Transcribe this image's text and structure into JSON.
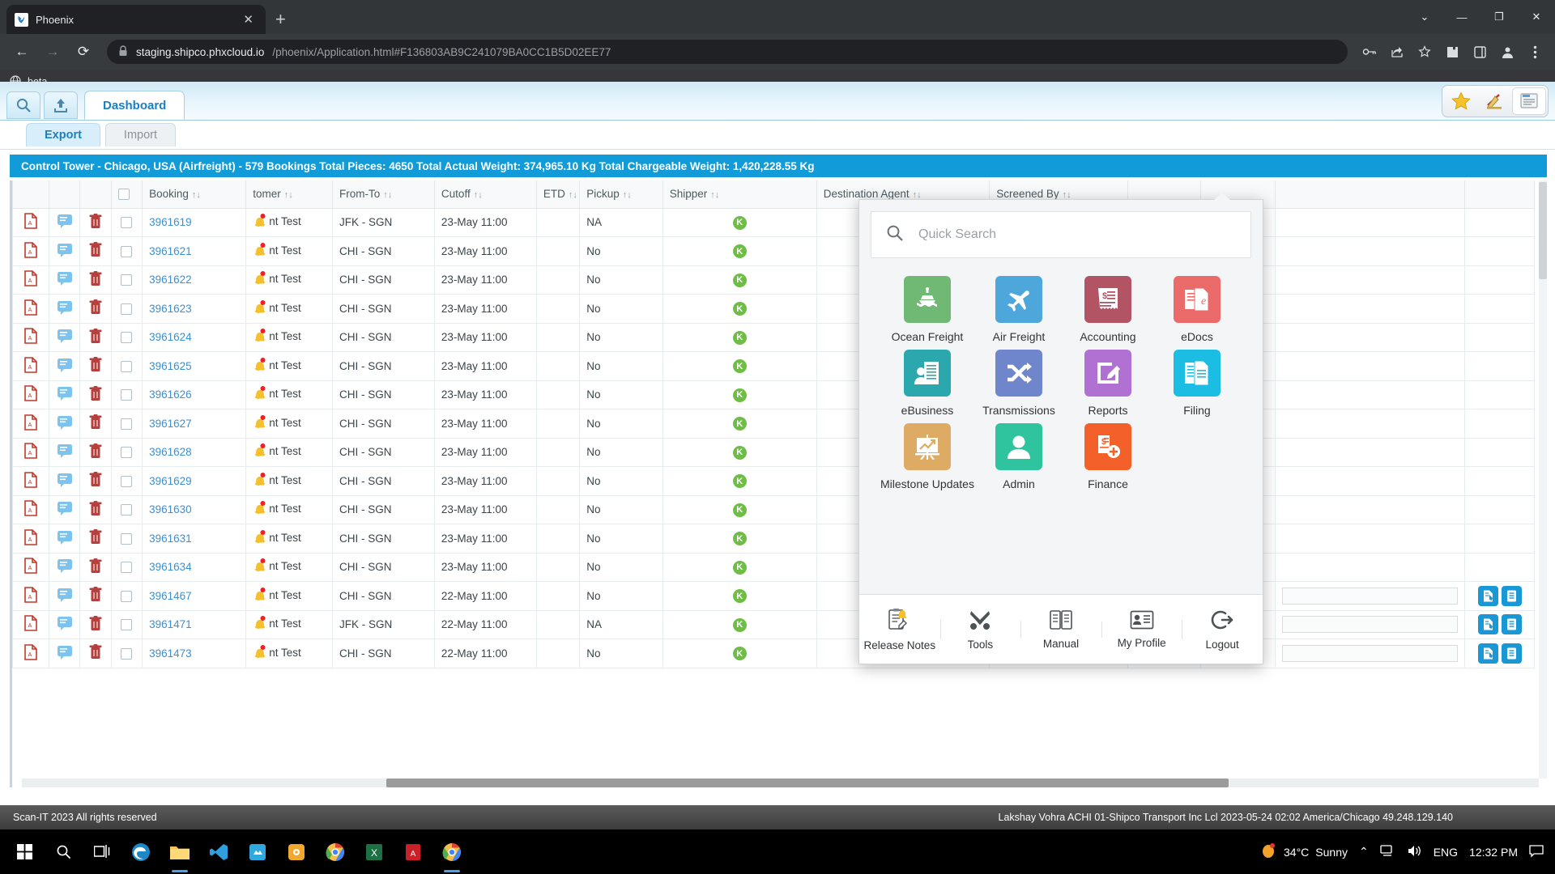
{
  "browser": {
    "tab_title": "Phoenix",
    "tab_close": "✕",
    "new_tab": "+",
    "url_host": "staging.shipco.phxcloud.io",
    "url_rest": "/phoenix/Application.html#F136803AB9C241079BA0CC1B5D02EE77",
    "back": "←",
    "forward": "→",
    "reload": "⟳",
    "bookmark_label": "beta",
    "win_minimize": "—",
    "win_maximize": "❐",
    "win_close": "✕",
    "win_chevron": "⌄"
  },
  "app": {
    "tab_dashboard": "Dashboard",
    "subtab_export": "Export",
    "subtab_import": "Import",
    "info_bar": "Control Tower - Chicago, USA (Airfreight) - 579 Bookings Total Pieces: 4650 Total Actual Weight: 374,965.10 Kg Total Chargeable Weight: 1,420,228.55 Kg"
  },
  "table": {
    "columns": [
      "Booking",
      "tomer",
      "From-To",
      "Cutoff",
      "ETD",
      "Pickup",
      "Shipper",
      "Destination Agent",
      "Screened By"
    ],
    "sort_glyph": "↑↓",
    "rows": [
      {
        "booking": "3961619",
        "customer": "nt Test",
        "fromto": "JFK - SGN",
        "cutoff": "23-May 11:00",
        "etd": "",
        "pickup": "NA",
        "shipper": "K",
        "dest_agent": "",
        "screened_by": ""
      },
      {
        "booking": "3961621",
        "customer": "nt Test",
        "fromto": "CHI - SGN",
        "cutoff": "23-May 11:00",
        "etd": "",
        "pickup": "No",
        "shipper": "K",
        "dest_agent": "",
        "screened_by": ""
      },
      {
        "booking": "3961622",
        "customer": "nt Test",
        "fromto": "CHI - SGN",
        "cutoff": "23-May 11:00",
        "etd": "",
        "pickup": "No",
        "shipper": "K",
        "dest_agent": "",
        "screened_by": ""
      },
      {
        "booking": "3961623",
        "customer": "nt Test",
        "fromto": "CHI - SGN",
        "cutoff": "23-May 11:00",
        "etd": "",
        "pickup": "No",
        "shipper": "K",
        "dest_agent": "",
        "screened_by": ""
      },
      {
        "booking": "3961624",
        "customer": "nt Test",
        "fromto": "CHI - SGN",
        "cutoff": "23-May 11:00",
        "etd": "",
        "pickup": "No",
        "shipper": "K",
        "dest_agent": "",
        "screened_by": ""
      },
      {
        "booking": "3961625",
        "customer": "nt Test",
        "fromto": "CHI - SGN",
        "cutoff": "23-May 11:00",
        "etd": "",
        "pickup": "No",
        "shipper": "K",
        "dest_agent": "",
        "screened_by": ""
      },
      {
        "booking": "3961626",
        "customer": "nt Test",
        "fromto": "CHI - SGN",
        "cutoff": "23-May 11:00",
        "etd": "",
        "pickup": "No",
        "shipper": "K",
        "dest_agent": "",
        "screened_by": ""
      },
      {
        "booking": "3961627",
        "customer": "nt Test",
        "fromto": "CHI - SGN",
        "cutoff": "23-May 11:00",
        "etd": "",
        "pickup": "No",
        "shipper": "K",
        "dest_agent": "",
        "screened_by": ""
      },
      {
        "booking": "3961628",
        "customer": "nt Test",
        "fromto": "CHI - SGN",
        "cutoff": "23-May 11:00",
        "etd": "",
        "pickup": "No",
        "shipper": "K",
        "dest_agent": "",
        "screened_by": ""
      },
      {
        "booking": "3961629",
        "customer": "nt Test",
        "fromto": "CHI - SGN",
        "cutoff": "23-May 11:00",
        "etd": "",
        "pickup": "No",
        "shipper": "K",
        "dest_agent": "",
        "screened_by": ""
      },
      {
        "booking": "3961630",
        "customer": "nt Test",
        "fromto": "CHI - SGN",
        "cutoff": "23-May 11:00",
        "etd": "",
        "pickup": "No",
        "shipper": "K",
        "dest_agent": "",
        "screened_by": ""
      },
      {
        "booking": "3961631",
        "customer": "nt Test",
        "fromto": "CHI - SGN",
        "cutoff": "23-May 11:00",
        "etd": "",
        "pickup": "No",
        "shipper": "K",
        "dest_agent": "",
        "screened_by": ""
      },
      {
        "booking": "3961634",
        "customer": "nt Test",
        "fromto": "CHI - SGN",
        "cutoff": "23-May 11:00",
        "etd": "",
        "pickup": "No",
        "shipper": "K",
        "dest_agent": "",
        "screened_by": ""
      },
      {
        "booking": "3961467",
        "customer": "nt Test",
        "fromto": "CHI - SGN",
        "cutoff": "22-May 11:00",
        "etd": "",
        "pickup": "No",
        "shipper": "K",
        "dest_agent": "",
        "screened_by": ""
      },
      {
        "booking": "3961471",
        "customer": "nt Test",
        "fromto": "JFK - SGN",
        "cutoff": "22-May 11:00",
        "etd": "",
        "pickup": "NA",
        "shipper": "K",
        "dest_agent": "",
        "screened_by": ""
      },
      {
        "booking": "3961473",
        "customer": "nt Test",
        "fromto": "CHI - SGN",
        "cutoff": "22-May 11:00",
        "etd": "",
        "pickup": "No",
        "shipper": "K",
        "dest_agent": "",
        "screened_by": ""
      }
    ]
  },
  "popup": {
    "search_placeholder": "Quick Search",
    "tiles": [
      {
        "label": "Ocean Freight",
        "icon": "ship-icon",
        "color": "#70b974"
      },
      {
        "label": "Air Freight",
        "icon": "plane-icon",
        "color": "#4ea7da"
      },
      {
        "label": "Accounting",
        "icon": "invoice-icon",
        "color": "#b35465"
      },
      {
        "label": "eDocs",
        "icon": "edocs-icon",
        "color": "#eb6a6a"
      },
      {
        "label": "eBusiness",
        "icon": "ebusiness-icon",
        "color": "#2aa8ae"
      },
      {
        "label": "Transmissions",
        "icon": "shuffle-icon",
        "color": "#6f85cc"
      },
      {
        "label": "Reports",
        "icon": "edit-square-icon",
        "color": "#b071d2"
      },
      {
        "label": "Filing",
        "icon": "filing-icon",
        "color": "#1bbde2"
      },
      {
        "label": "Milestone Updates",
        "icon": "chart-board-icon",
        "color": "#ddab64"
      },
      {
        "label": "Admin",
        "icon": "person-icon",
        "color": "#2fc39e"
      },
      {
        "label": "Finance",
        "icon": "finance-icon",
        "color": "#f4602a"
      }
    ],
    "footer": [
      {
        "label": "Release Notes",
        "icon": "release-notes-icon"
      },
      {
        "label": "Tools",
        "icon": "tools-icon"
      },
      {
        "label": "Manual",
        "icon": "book-icon"
      },
      {
        "label": "My Profile",
        "icon": "id-card-icon"
      },
      {
        "label": "Logout",
        "icon": "logout-icon"
      }
    ]
  },
  "status": {
    "left": "Scan-IT 2023 All rights reserved",
    "right": "Lakshay Vohra ACHI 01-Shipco Transport Inc Lcl 2023-05-24 02:02 America/Chicago 49.248.129.140"
  },
  "taskbar": {
    "weather_temp": "34°C",
    "weather_desc": "Sunny",
    "language": "ENG",
    "clock": "12:32 PM",
    "chevron": "⌃"
  }
}
